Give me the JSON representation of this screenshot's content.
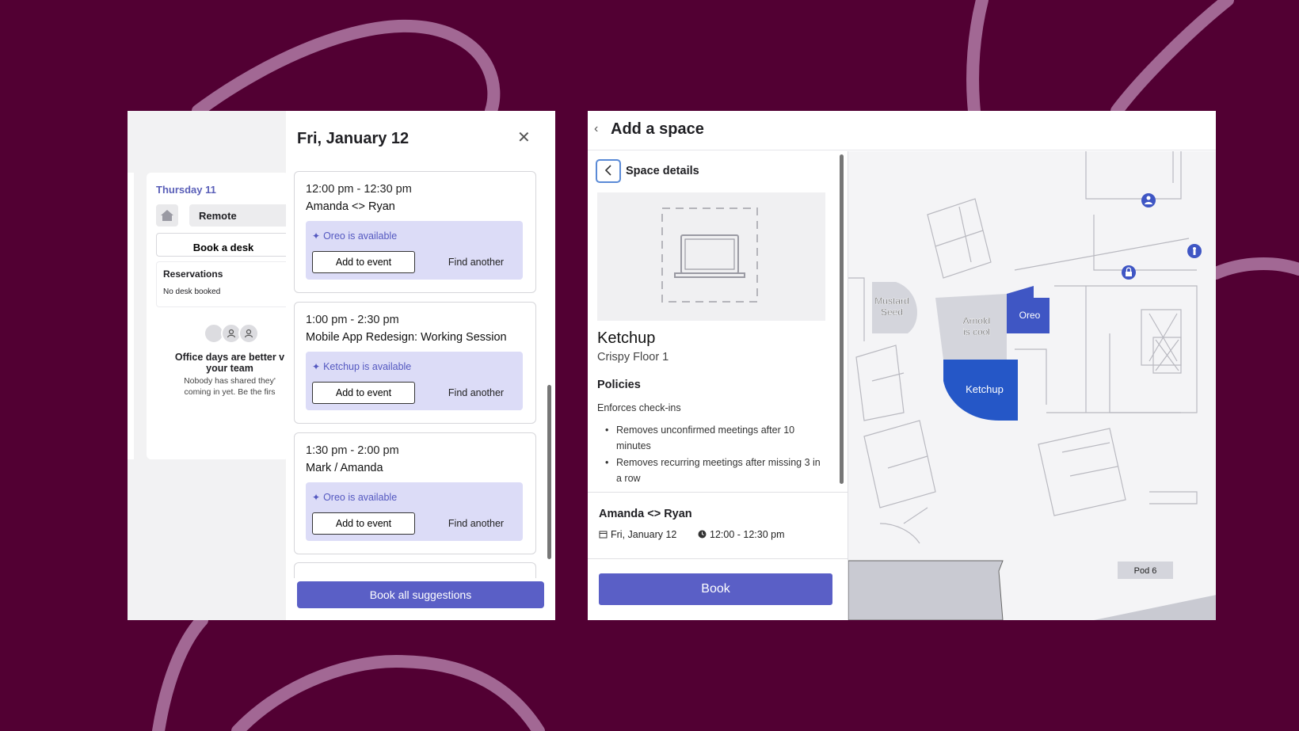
{
  "left": {
    "day_title": "Thursday 11",
    "remote_label": "Remote",
    "book_desk_label": "Book a desk",
    "reservations_title": "Reservations",
    "reservations_empty": "No desk booked",
    "office_title_l1": "Office days are better v",
    "office_title_l2": "your team",
    "office_sub_l1": "Nobody has shared they'",
    "office_sub_l2": "coming in yet. Be the firs"
  },
  "drawer": {
    "title": "Fri, January 12",
    "close_glyph": "✕",
    "events": [
      {
        "time": "12:00 pm - 12:30 pm",
        "name": "Amanda <> Ryan",
        "suggestion": "Oreo is available",
        "add_label": "Add to event",
        "find_label": "Find another"
      },
      {
        "time": "1:00 pm - 2:30 pm",
        "name": "Mobile App Redesign: Working Session",
        "suggestion": "Ketchup is available",
        "add_label": "Add to event",
        "find_label": "Find another"
      },
      {
        "time": "1:30 pm - 2:00 pm",
        "name": "Mark / Amanda",
        "suggestion": "Oreo is available",
        "add_label": "Add to event",
        "find_label": "Find another"
      }
    ],
    "book_all_label": "Book all suggestions"
  },
  "space": {
    "header_title": "Add a space",
    "details_label": "Space details",
    "name": "Ketchup",
    "floor": "Crispy Floor 1",
    "policies_title": "Policies",
    "policy_sub": "Enforces check-ins",
    "rules": [
      "Removes unconfirmed meetings after 10 minutes",
      "Removes recurring meetings after missing 3 in a row"
    ],
    "meeting_name": "Amanda <> Ryan",
    "meeting_date": "Fri, January 12",
    "meeting_time": "12:00 - 12:30 pm",
    "book_label": "Book"
  },
  "map": {
    "rooms": {
      "mustard_l1": "Mustard",
      "mustard_l2": "Seed",
      "arnold_l1": "Arnold",
      "arnold_l2": "is cool",
      "oreo": "Oreo",
      "ketchup": "Ketchup",
      "pod": "Pod 6"
    }
  },
  "colors": {
    "background": "#520033",
    "accent": "#5a5fc6",
    "suggestion_bg": "#dcdcf7",
    "room_selected": "#2557c7",
    "room_other": "#d4d5dc"
  },
  "icons": [
    "home-icon",
    "person-icon",
    "sparkle-icon",
    "close-icon",
    "chevron-left-icon",
    "laptop-icon",
    "calendar-icon",
    "clock-icon",
    "lock-icon"
  ]
}
